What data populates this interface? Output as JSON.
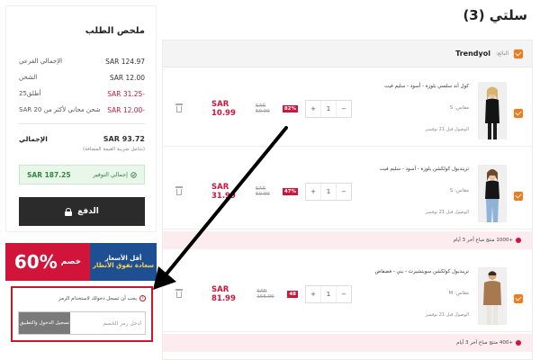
{
  "summary": {
    "title": "ملخص الطلب",
    "rows": [
      {
        "label": "الإجمالي الفرعي",
        "value": "SAR 124.97"
      },
      {
        "label": "الشحن",
        "value": "SAR 12.00"
      },
      {
        "label": "أطلق25",
        "value": "SAR 31.25-"
      },
      {
        "label": "شحن مجاني لأكثر من SAR 20",
        "value": "SAR 12.00-"
      }
    ],
    "total_label": "الإجمالي",
    "total_value": "SAR 93.72",
    "vat_note": "(شامل ضريبة القيمة المضافة)",
    "savings_label": "إجمالي التوفير",
    "savings_value": "SAR 187.25",
    "pay_button": "الدفع"
  },
  "promo_banner": {
    "percent": "60%",
    "discount_word": "خصم",
    "line1": "أقل الأسعار",
    "line2": "سعادة تفوق الأنظار",
    "colors": {
      "red": "#d0143a",
      "blue": "#1f4f93"
    }
  },
  "coupon": {
    "message": "يجب أن تسجل دخولك لاستخدام الرمز",
    "placeholder": "أدخل رمز الخصم",
    "button_label": "تسجيل الدخول والتطبيق"
  },
  "cart": {
    "title": "سلتي (3)",
    "seller_label": "البائع:",
    "seller_name": "Trendyol",
    "items": [
      {
        "name": "كول أند سلسي بلوزة - أسود - سليم فيت",
        "size": "مقاس: S",
        "delivery": "الوصول قبل 21 نوفمبر",
        "quantity": "1",
        "discount": "82%",
        "old_price": "SAR 59.99",
        "price": "SAR 10.99"
      },
      {
        "name": "تريندبول كولكشن بلوزة - أسود - سليم فيت",
        "size": "مقاس: S",
        "delivery": "الوصول قبل 21 نوفمبر",
        "quantity": "1",
        "discount": "47%",
        "old_price": "SAR 59.99",
        "price": "SAR 31.99"
      },
      {
        "name": "تريندبول كولكشن سويتشيرت - بني - فضفاض",
        "size": "مقاس: M",
        "delivery": "الوصول قبل 21 نوفمبر",
        "quantity": "1",
        "discount": "48",
        "old_price": "SAR 156.99",
        "price": "SAR 81.99"
      }
    ],
    "promo_strips": [
      "+1000 منتج مباع آخر 3 أيام",
      "+400 منتج مباع آخر 3 أيام"
    ]
  },
  "icons": {
    "checkbox": "checkbox-checked-icon",
    "trash": "trash-icon",
    "lock": "lock-icon",
    "info": "info-icon",
    "savings": "savings-icon",
    "accent": "#f27a1a"
  }
}
